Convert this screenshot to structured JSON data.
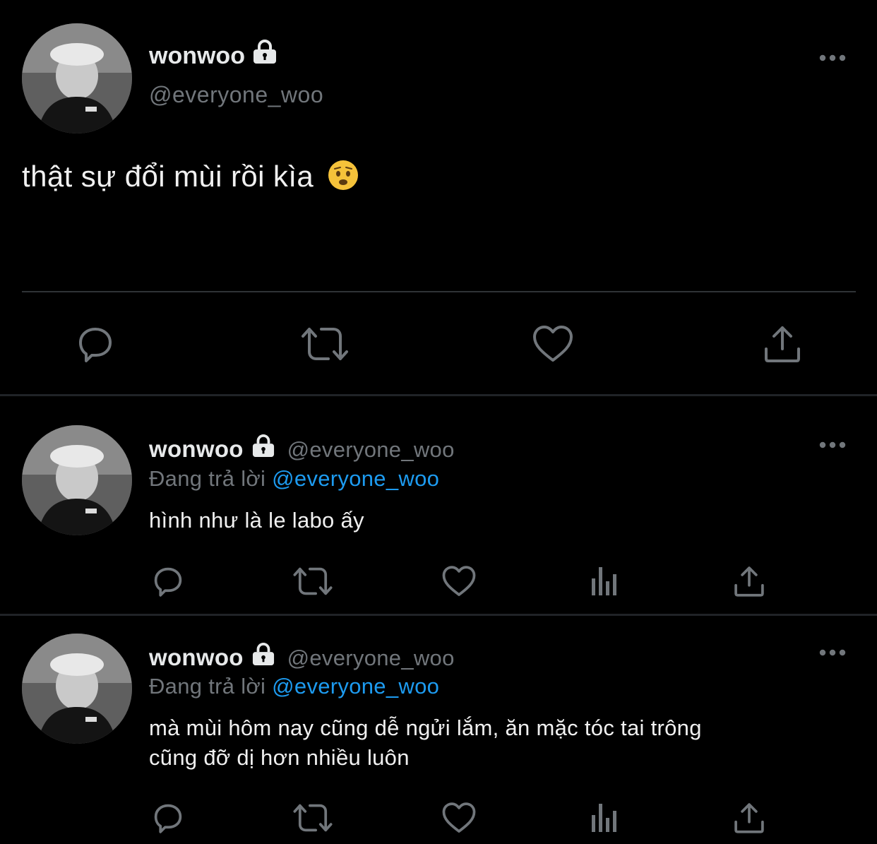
{
  "colors": {
    "background": "#000000",
    "text": "#e7e9ea",
    "secondary": "#71767b",
    "link": "#1d9bf0",
    "divider": "#2f3336"
  },
  "main_tweet": {
    "name": "wonwoo",
    "handle": "@everyone_woo",
    "text": "thật sự đổi mùi rồi kìa",
    "emoji": "😟",
    "actions": [
      "reply-icon",
      "retweet-icon",
      "like-icon",
      "share-icon"
    ]
  },
  "replies": [
    {
      "name": "wonwoo",
      "handle": "@everyone_woo",
      "replying_prefix": "Đang trả lời",
      "replying_to": "@everyone_woo",
      "text_lines": [
        "hình như là le labo ấy"
      ],
      "actions": [
        "reply-icon",
        "retweet-icon",
        "like-icon",
        "analytics-icon",
        "share-icon"
      ]
    },
    {
      "name": "wonwoo",
      "handle": "@everyone_woo",
      "replying_prefix": "Đang trả lời",
      "replying_to": "@everyone_woo",
      "text_lines": [
        "mà mùi hôm nay cũng dễ ngửi lắm, ăn mặc tóc tai trông",
        "cũng đỡ dị hơn nhiều luôn"
      ],
      "actions": [
        "reply-icon",
        "retweet-icon",
        "like-icon",
        "analytics-icon",
        "share-icon"
      ]
    }
  ]
}
